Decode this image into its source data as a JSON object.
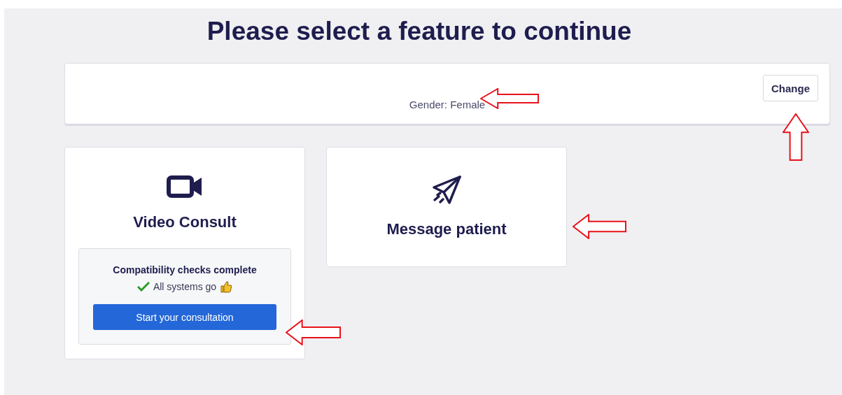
{
  "title": "Please select a feature to continue",
  "patient": {
    "details": "Gender: Female",
    "action": "Change"
  },
  "features": [
    {
      "kind": "video",
      "label": "Video Consult",
      "check": {
        "heading": "Compatibility checks complete",
        "status": "All systems go",
        "button": "Start your consultation"
      }
    },
    {
      "kind": "message",
      "label": "Message patient"
    }
  ],
  "annotations": [
    {
      "kind": "left"
    },
    {
      "kind": "up"
    },
    {
      "kind": "left"
    },
    {
      "kind": "left"
    }
  ]
}
